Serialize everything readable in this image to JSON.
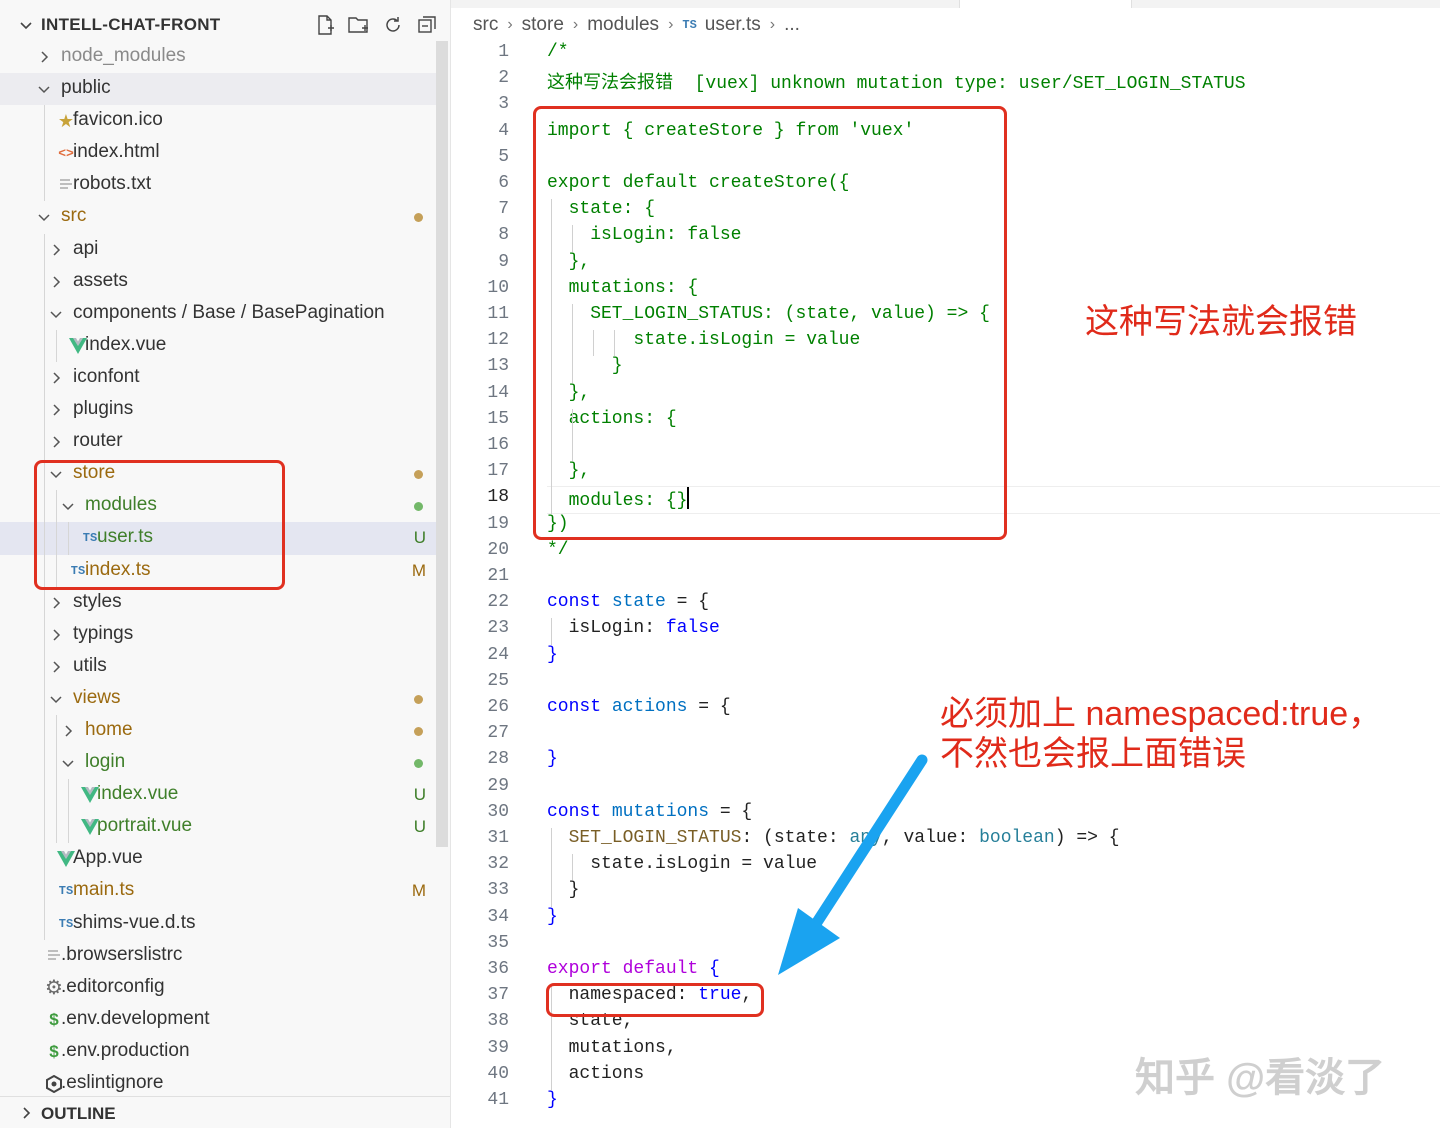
{
  "explorer": {
    "title": "INTELL-CHAT-FRONT",
    "actions": [
      "new-file-icon",
      "new-folder-icon",
      "refresh-icon",
      "collapse-all-icon"
    ],
    "items": [
      {
        "label": "node_modules",
        "depth": 1,
        "kind": "folder",
        "open": false,
        "dim": true
      },
      {
        "label": "public",
        "depth": 1,
        "kind": "folder",
        "open": true
      },
      {
        "label": "favicon.ico",
        "depth": 2,
        "kind": "file",
        "icon": "star-icon"
      },
      {
        "label": "index.html",
        "depth": 2,
        "kind": "file",
        "icon": "html-icon"
      },
      {
        "label": "robots.txt",
        "depth": 2,
        "kind": "file",
        "icon": "text-file-icon"
      },
      {
        "label": "src",
        "depth": 1,
        "kind": "folder",
        "open": true,
        "status": "mod",
        "dot": "#c5a059"
      },
      {
        "label": "api",
        "depth": 2,
        "kind": "folder",
        "open": false
      },
      {
        "label": "assets",
        "depth": 2,
        "kind": "folder",
        "open": false
      },
      {
        "label": "components / Base / BasePagination",
        "depth": 2,
        "kind": "folder",
        "open": true
      },
      {
        "label": "index.vue",
        "depth": 3,
        "kind": "file",
        "icon": "vue-icon"
      },
      {
        "label": "iconfont",
        "depth": 2,
        "kind": "folder",
        "open": false
      },
      {
        "label": "plugins",
        "depth": 2,
        "kind": "folder",
        "open": false
      },
      {
        "label": "router",
        "depth": 2,
        "kind": "folder",
        "open": false
      },
      {
        "label": "store",
        "depth": 2,
        "kind": "folder",
        "open": true,
        "status": "mod",
        "dot": "#c5a059"
      },
      {
        "label": "modules",
        "depth": 3,
        "kind": "folder",
        "open": true,
        "status": "untr",
        "dot": "#73b869"
      },
      {
        "label": "user.ts",
        "depth": 4,
        "kind": "file",
        "icon": "ts-icon",
        "status": "untr",
        "badge": "U",
        "selected": true
      },
      {
        "label": "index.ts",
        "depth": 3,
        "kind": "file",
        "icon": "ts-icon",
        "status": "mod",
        "badge": "M"
      },
      {
        "label": "styles",
        "depth": 2,
        "kind": "folder",
        "open": false
      },
      {
        "label": "typings",
        "depth": 2,
        "kind": "folder",
        "open": false
      },
      {
        "label": "utils",
        "depth": 2,
        "kind": "folder",
        "open": false
      },
      {
        "label": "views",
        "depth": 2,
        "kind": "folder",
        "open": true,
        "status": "mod",
        "dot": "#c5a059"
      },
      {
        "label": "home",
        "depth": 3,
        "kind": "folder",
        "open": false,
        "status": "mod",
        "dot": "#c5a059"
      },
      {
        "label": "login",
        "depth": 3,
        "kind": "folder",
        "open": true,
        "status": "untr",
        "dot": "#73b869"
      },
      {
        "label": "index.vue",
        "depth": 4,
        "kind": "file",
        "icon": "vue-icon",
        "status": "untr",
        "badge": "U"
      },
      {
        "label": "portrait.vue",
        "depth": 4,
        "kind": "file",
        "icon": "vue-icon",
        "status": "untr",
        "badge": "U"
      },
      {
        "label": "App.vue",
        "depth": 2,
        "kind": "file",
        "icon": "vue-icon"
      },
      {
        "label": "main.ts",
        "depth": 2,
        "kind": "file",
        "icon": "ts-icon",
        "status": "mod",
        "badge": "M"
      },
      {
        "label": "shims-vue.d.ts",
        "depth": 2,
        "kind": "file",
        "icon": "ts-icon"
      },
      {
        "label": ".browserslistrc",
        "depth": 1,
        "kind": "file",
        "icon": "text-file-icon"
      },
      {
        "label": ".editorconfig",
        "depth": 1,
        "kind": "file",
        "icon": "gear-icon"
      },
      {
        "label": ".env.development",
        "depth": 1,
        "kind": "file",
        "icon": "dollar-icon"
      },
      {
        "label": ".env.production",
        "depth": 1,
        "kind": "file",
        "icon": "dollar-icon"
      },
      {
        "label": ".eslintignore",
        "depth": 1,
        "kind": "file",
        "icon": "eslint-icon"
      }
    ],
    "outline_label": "OUTLINE"
  },
  "breadcrumb": {
    "parts": [
      "src",
      "store",
      "modules"
    ],
    "file_icon": "TS",
    "file": "user.ts",
    "tail": "..."
  },
  "colors": {
    "folder_modified": "#9b6a10",
    "untracked": "#3f7f2a",
    "annotation_red": "#e02a1a",
    "arrow_blue": "#1aa3f0"
  },
  "editor": {
    "current_line": 18,
    "lines": [
      [
        {
          "t": "/*",
          "c": "comment"
        }
      ],
      [
        {
          "t": "这种写法会报错  [vuex] unknown mutation type: user/SET_LOGIN_STATUS",
          "c": "comment"
        }
      ],
      [],
      [
        {
          "t": "import { createStore } from 'vuex'",
          "c": "comment"
        }
      ],
      [],
      [
        {
          "t": "export default createStore({",
          "c": "comment"
        }
      ],
      [
        {
          "t": "  state: {",
          "c": "comment"
        }
      ],
      [
        {
          "t": "    isLogin: false",
          "c": "comment"
        }
      ],
      [
        {
          "t": "  },",
          "c": "comment"
        }
      ],
      [
        {
          "t": "  mutations: {",
          "c": "comment"
        }
      ],
      [
        {
          "t": "    SET_LOGIN_STATUS: (state, value) => {",
          "c": "comment"
        }
      ],
      [
        {
          "t": "        state.isLogin = value",
          "c": "comment"
        }
      ],
      [
        {
          "t": "      }",
          "c": "comment"
        }
      ],
      [
        {
          "t": "  },",
          "c": "comment"
        }
      ],
      [
        {
          "t": "  actions: {",
          "c": "comment"
        }
      ],
      [],
      [
        {
          "t": "  },",
          "c": "comment"
        }
      ],
      [
        {
          "t": "  modules: {}",
          "c": "comment"
        }
      ],
      [
        {
          "t": "})",
          "c": "comment"
        }
      ],
      [
        {
          "t": "*/",
          "c": "comment"
        }
      ],
      [],
      [
        {
          "t": "const ",
          "c": "k"
        },
        {
          "t": "state",
          "c": "v"
        },
        {
          "t": " = {",
          "c": "pn"
        }
      ],
      [
        {
          "t": "  isLogin: ",
          "c": "pn"
        },
        {
          "t": "false",
          "c": "k"
        }
      ],
      [
        {
          "t": "}",
          "c": "k"
        }
      ],
      [],
      [
        {
          "t": "const ",
          "c": "k"
        },
        {
          "t": "actions",
          "c": "v"
        },
        {
          "t": " = {",
          "c": "pn"
        }
      ],
      [],
      [
        {
          "t": "}",
          "c": "k"
        }
      ],
      [],
      [
        {
          "t": "const ",
          "c": "k"
        },
        {
          "t": "mutations",
          "c": "v"
        },
        {
          "t": " = {",
          "c": "pn"
        }
      ],
      [
        {
          "t": "  SET_LOGIN_STATUS",
          "c": "f"
        },
        {
          "t": ": (",
          "c": "pn"
        },
        {
          "t": "state",
          "c": "pn"
        },
        {
          "t": ": ",
          "c": "pn"
        },
        {
          "t": "any",
          "c": "ty"
        },
        {
          "t": ", value: ",
          "c": "pn"
        },
        {
          "t": "boolean",
          "c": "ty"
        },
        {
          "t": ") => {",
          "c": "pn"
        }
      ],
      [
        {
          "t": "    state.isLogin = value",
          "c": "pn"
        }
      ],
      [
        {
          "t": "  }",
          "c": "pn"
        }
      ],
      [
        {
          "t": "}",
          "c": "k"
        }
      ],
      [],
      [
        {
          "t": "export default ",
          "c": "kp"
        },
        {
          "t": "{",
          "c": "k"
        }
      ],
      [
        {
          "t": "  namespaced: ",
          "c": "pn"
        },
        {
          "t": "true",
          "c": "k"
        },
        {
          "t": ",",
          "c": "pn"
        }
      ],
      [
        {
          "t": "  state,",
          "c": "pn"
        }
      ],
      [
        {
          "t": "  mutations,",
          "c": "pn"
        }
      ],
      [
        {
          "t": "  actions",
          "c": "pn"
        }
      ],
      [
        {
          "t": "}",
          "c": "k"
        }
      ]
    ]
  },
  "annotations": {
    "red_note": "这种写法就会报错",
    "blue_note_line1": "必须加上 namespaced:true，",
    "blue_note_line2": "不然也会报上面错误"
  },
  "watermark": "知乎 @看淡了"
}
